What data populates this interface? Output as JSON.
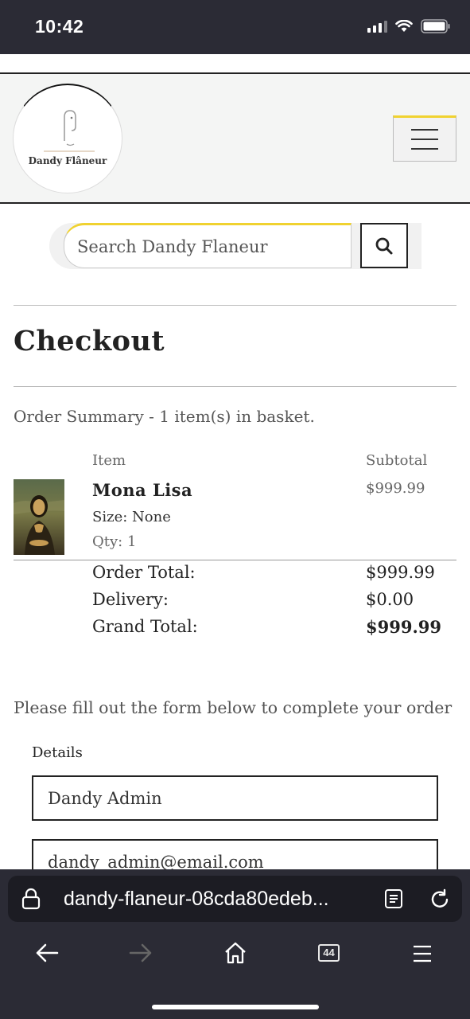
{
  "status": {
    "time": "10:42"
  },
  "header": {
    "logo_text": "Dandy Flâneur"
  },
  "search": {
    "placeholder": "Search Dandy Flaneur"
  },
  "page": {
    "title": "Checkout"
  },
  "order": {
    "summary": "Order Summary - 1 item(s) in basket.",
    "col_item": "Item",
    "col_subtotal": "Subtotal",
    "item": {
      "name": "Mona Lisa",
      "size": "Size: None",
      "qty": "Qty: 1",
      "subtotal": "$999.99"
    },
    "order_total_label": "Order Total:",
    "order_total": "$999.99",
    "delivery_label": "Delivery:",
    "delivery": "$0.00",
    "grand_total_label": "Grand Total:",
    "grand_total": "$999.99"
  },
  "form": {
    "instructions": "Please fill out the form below to complete your order",
    "details_label": "Details",
    "full_name": "Dandy Admin",
    "email": "dandy_admin@email.com"
  },
  "browser": {
    "url": "dandy-flaneur-08cda80edeb...",
    "tab_count": "44"
  }
}
